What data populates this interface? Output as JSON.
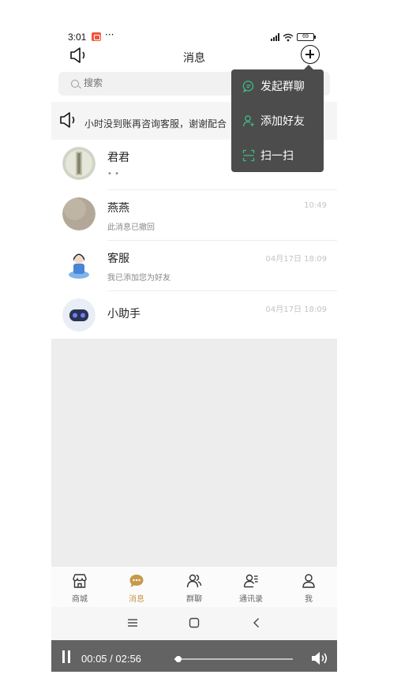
{
  "status_bar": {
    "time": "3:01",
    "more": "···",
    "battery": "69"
  },
  "header": {
    "title": "消息"
  },
  "search": {
    "placeholder": "搜索"
  },
  "notice": {
    "text": "小时没到账再咨询客服，谢谢配合"
  },
  "popup_menu": {
    "items": [
      {
        "label": "发起群聊",
        "icon": "group-chat-icon"
      },
      {
        "label": "添加好友",
        "icon": "add-friend-icon"
      },
      {
        "label": "扫一扫",
        "icon": "scan-icon"
      }
    ],
    "icon_color": "#3fb984"
  },
  "conversations": [
    {
      "name": "君君",
      "preview": "• •",
      "time": ""
    },
    {
      "name": "燕燕",
      "preview": "此消息已撤回",
      "time": "10:49"
    },
    {
      "name": "客服",
      "preview": "我已添加您为好友",
      "time": "04月17日 18:09"
    },
    {
      "name": "小助手",
      "preview": "",
      "time": "04月17日 18:09"
    }
  ],
  "tabs": [
    {
      "label": "商城",
      "icon": "shop-icon",
      "active": false
    },
    {
      "label": "消息",
      "icon": "message-icon",
      "active": true
    },
    {
      "label": "群聊",
      "icon": "group-icon",
      "active": false
    },
    {
      "label": "通讯录",
      "icon": "contacts-icon",
      "active": false
    },
    {
      "label": "我",
      "icon": "profile-icon",
      "active": false
    }
  ],
  "colors": {
    "accent": "#c69a4a",
    "menu_bg": "#4c4c4c",
    "player_bg": "#636363"
  },
  "player": {
    "time": "00:05 / 02:56",
    "progress": 0.03
  }
}
